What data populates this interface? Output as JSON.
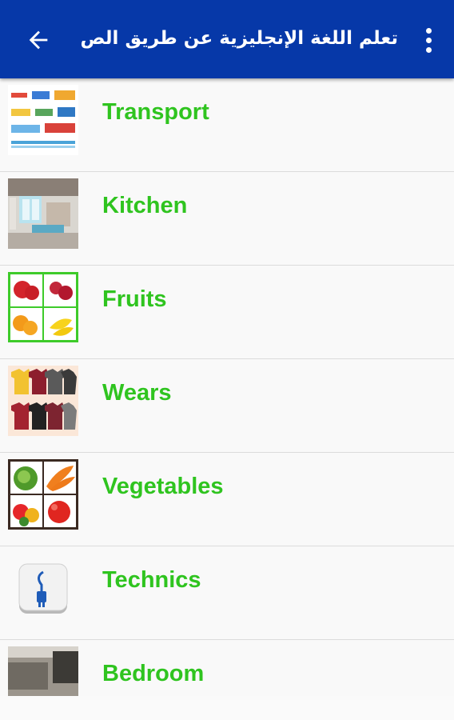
{
  "appbar": {
    "title": "تعلم اللغة الإنجليزية عن طريق الص...",
    "back_icon": "arrow-left-icon",
    "menu_icon": "more-vert-icon",
    "color": "#0638a8"
  },
  "categories": [
    {
      "label": "Transport",
      "icon": "transport-thumbnail"
    },
    {
      "label": "Kitchen",
      "icon": "kitchen-thumbnail"
    },
    {
      "label": "Fruits",
      "icon": "fruits-thumbnail"
    },
    {
      "label": "Wears",
      "icon": "wears-thumbnail"
    },
    {
      "label": "Vegetables",
      "icon": "vegetables-thumbnail"
    },
    {
      "label": "Technics",
      "icon": "plug-icon"
    },
    {
      "label": "Bedroom",
      "icon": "bedroom-thumbnail"
    }
  ],
  "label_color": "#2fc41f"
}
